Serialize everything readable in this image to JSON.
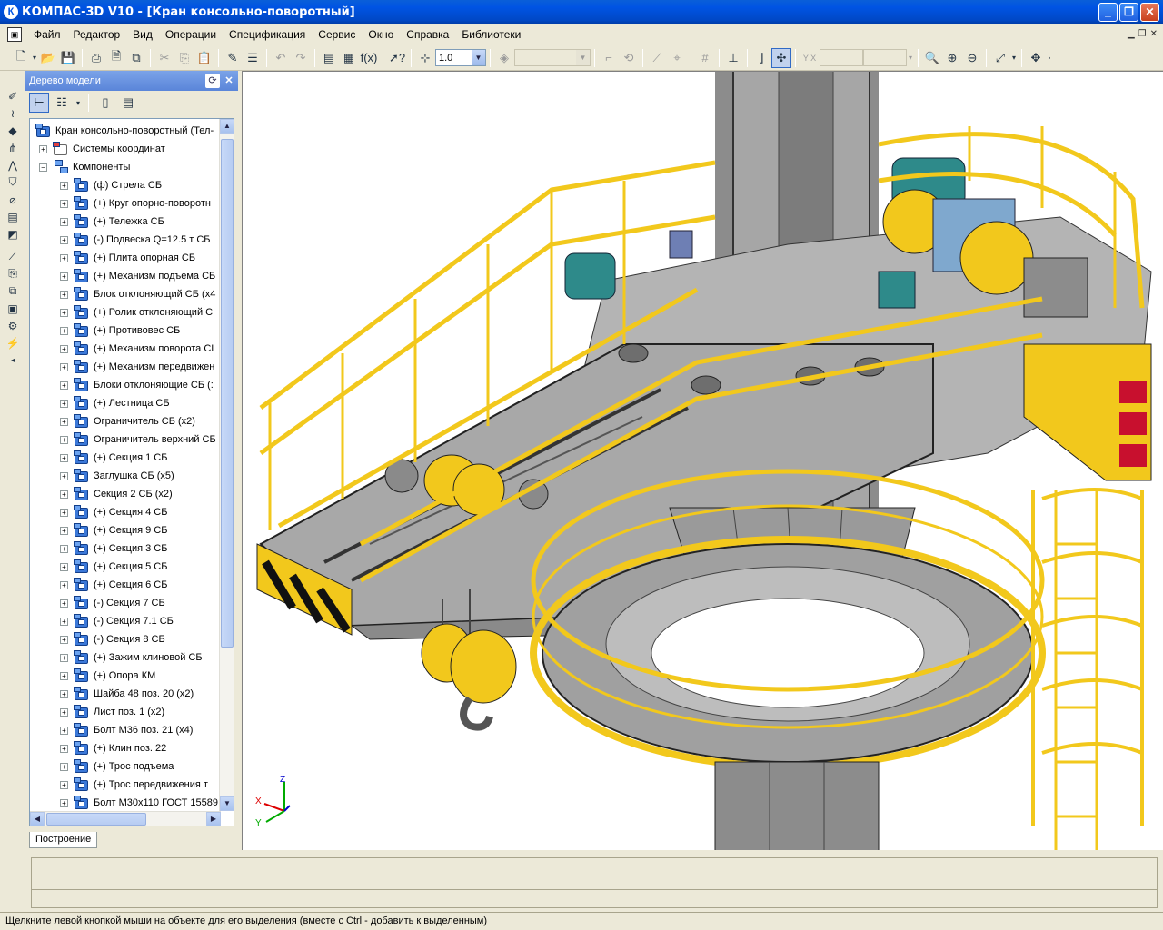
{
  "window": {
    "title": "КОМПАС-3D V10 - [Кран консольно-поворотный]",
    "app_icon": "К"
  },
  "menu": [
    "Файл",
    "Редактор",
    "Вид",
    "Операции",
    "Спецификация",
    "Сервис",
    "Окно",
    "Справка",
    "Библиотеки"
  ],
  "toolbar": {
    "scale_value": "1.0"
  },
  "tree": {
    "title": "Дерево модели",
    "root": "Кран консольно-поворотный (Тел-",
    "children": [
      {
        "label": "Системы координат",
        "type": "coord"
      },
      {
        "label": "Компоненты",
        "type": "group"
      }
    ],
    "components": [
      "(ф) Стрела СБ",
      "(+) Круг опорно-поворотн",
      "(+) Тележка СБ",
      "(-) Подвеска Q=12.5 т СБ",
      "(+) Плита опорная СБ",
      "(+) Механизм подъема СБ",
      "Блок отклоняющий СБ (x4",
      "(+) Ролик отклоняющий С",
      "(+) Противовес СБ",
      "(+) Механизм поворота СI",
      "(+) Механизм передвижен",
      "Блоки отклоняющие СБ (:",
      "(+) Лестница СБ",
      "Ограничитель СБ (x2)",
      "Ограничитель верхний СБ",
      "(+) Секция 1 СБ",
      "Заглушка СБ (x5)",
      "Секция 2 СБ (x2)",
      "(+) Секция 4 СБ",
      "(+) Секция 9 СБ",
      "(+) Секция 3 СБ",
      "(+) Секция 5 СБ",
      "(+) Секция 6 СБ",
      "(-) Секция 7 СБ",
      "(-) Секция 7.1 СБ",
      "(-) Секция 8 СБ",
      "(+) Зажим клиновой СБ",
      "(+) Опора КМ",
      "Шайба 48 поз. 20 (x2)",
      "Лист поз. 1 (x2)",
      "Болт М36 поз. 21 (x4)",
      "(+) Клин поз. 22",
      "(+) Трос подъема",
      "(+) Трос передвижения т",
      "Болт М30х110 ГОСТ 15589"
    ],
    "tab": "Построение"
  },
  "axes": {
    "x": "X",
    "y": "Y",
    "z": "Z"
  },
  "status": "Щелкните левой кнопкой мыши на объекте для его выделения (вместе с Ctrl - добавить к выделенным)",
  "colors": {
    "yellow": "#F2C81C",
    "steel": "#9C9C9C",
    "dark_steel": "#6E6E6E",
    "motor": "#2E8A8A",
    "gear": "#7FA8CE",
    "hazard": "#C8102E"
  }
}
